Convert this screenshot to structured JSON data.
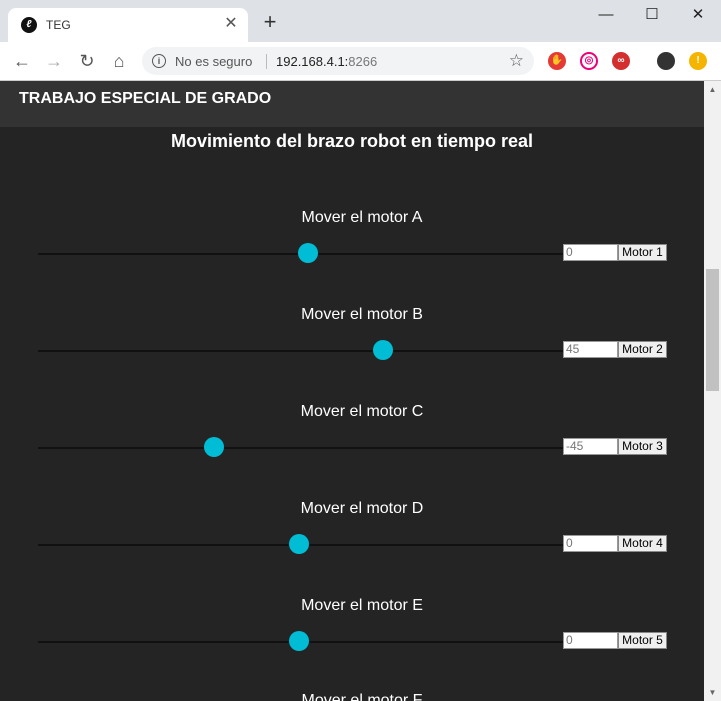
{
  "browser": {
    "tab_title": "TEG",
    "favicon_text": "ℓ",
    "security_label": "No es seguro",
    "url_host": "192.168.4.1:",
    "url_port": "8266",
    "new_tab": "+",
    "tab_close": "✕",
    "minimize": "—",
    "maximize": "☐",
    "close": "✕"
  },
  "page": {
    "header_title": "TRABAJO ESPECIAL DE GRADO",
    "heading": "Movimiento del brazo robot en tiempo real",
    "motors": [
      {
        "label": "Mover el motor A",
        "value": "0",
        "button": "Motor 1",
        "slider_fraction": 0.515
      },
      {
        "label": "Mover el motor B",
        "value": "45",
        "button": "Motor 2",
        "slider_fraction": 0.657
      },
      {
        "label": "Mover el motor C",
        "value": "-45",
        "button": "Motor 3",
        "slider_fraction": 0.335
      },
      {
        "label": "Mover el motor D",
        "value": "0",
        "button": "Motor 4",
        "slider_fraction": 0.497
      },
      {
        "label": "Mover el motor E",
        "value": "0",
        "button": "Motor 5",
        "slider_fraction": 0.497
      }
    ],
    "cut_off_label": "Mover el motor F"
  },
  "colors": {
    "accent": "#00bcd4",
    "page_bg": "#242424",
    "header_bg": "#333333"
  }
}
